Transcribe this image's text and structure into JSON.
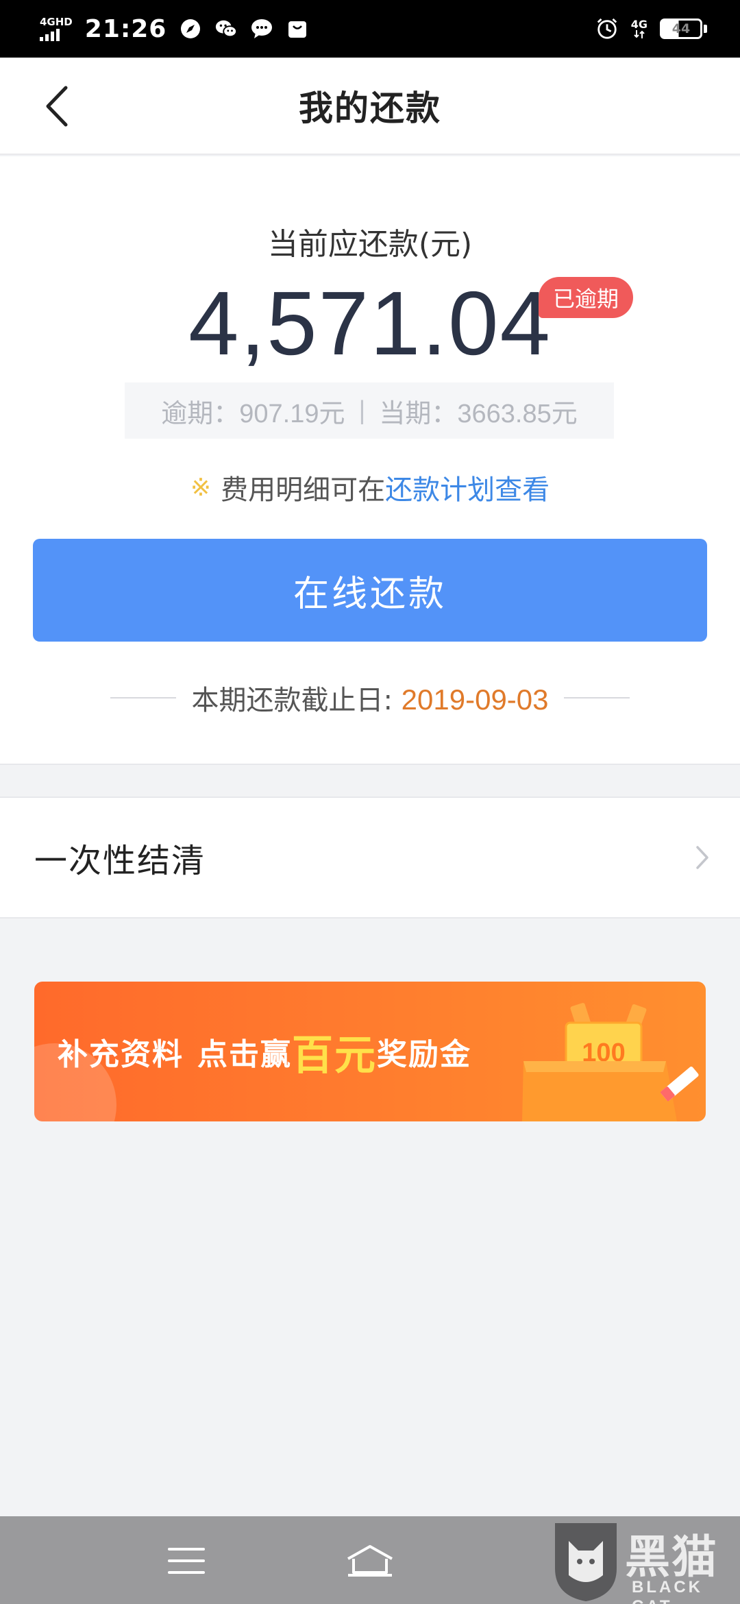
{
  "status_bar": {
    "network_label": "4GHD",
    "time": "21:26",
    "icons": [
      "compass-icon",
      "wechat-icon",
      "message-icon",
      "shopping-bag-icon",
      "alarm-icon"
    ],
    "network_right": "4G",
    "battery": "44"
  },
  "header": {
    "title": "我的还款",
    "back_icon": "chevron-left-icon"
  },
  "summary": {
    "label": "当前应还款(元)",
    "amount": "4,571.04",
    "badge": "已逾期",
    "overdue": "逾期：907.19元",
    "separator": "|",
    "current": "当期：3663.85元",
    "fee_note_mark": "※",
    "fee_note": "费用明细可在",
    "fee_note_link": "还款计划查看",
    "pay_button": "在线还款",
    "deadline_label": "本期还款截止日:",
    "deadline_date": "2019-09-03"
  },
  "settle": {
    "label": "一次性结清",
    "icon": "chevron-right-icon"
  },
  "banner": {
    "text_part1": "补充资料",
    "text_part2": "点击赢",
    "text_highlight": "百元",
    "text_part3": "奖励金",
    "ticket_value": "100"
  },
  "nav": {
    "icons": [
      "menu-icon",
      "home-icon",
      "back-icon"
    ]
  },
  "watermark": {
    "text": "黑猫",
    "subtext": "BLACK CAT"
  },
  "colors": {
    "primary": "#5393f8",
    "badge": "#f05a5a",
    "link": "#3d88e6",
    "deadline": "#e07a2a",
    "banner": "#ff7c2e"
  }
}
